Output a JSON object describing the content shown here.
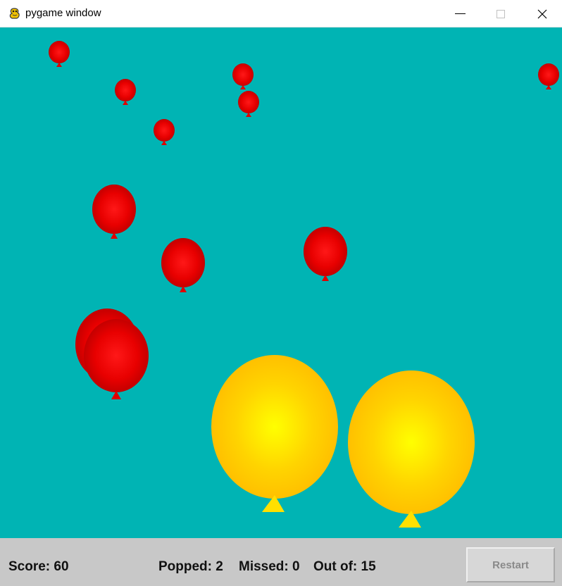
{
  "window": {
    "title": "pygame window",
    "icon": "pygame-snake-icon",
    "controls": [
      "minimize-icon",
      "maximize-icon",
      "close-icon"
    ]
  },
  "game": {
    "background_color": "#00b4b4",
    "balloon_colors": {
      "red": "#e50000",
      "yellow": "#ffc800"
    }
  },
  "hud": {
    "score": "Score: 60",
    "popped": "Popped: 2",
    "missed": "Missed: 0",
    "out_of": "Out of: 15",
    "restart_label": "Restart"
  }
}
